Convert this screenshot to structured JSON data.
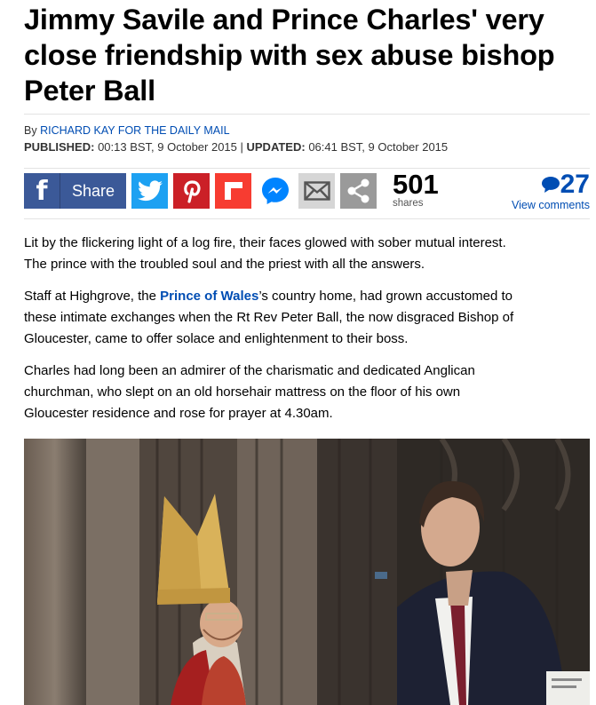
{
  "article": {
    "headline_lines": [
      "Jimmy Savile and Prince Charles' very",
      "close friendship with sex abuse bishop",
      "Peter Ball"
    ],
    "byline_prefix": "By ",
    "author": "RICHARD KAY FOR THE DAILY MAIL",
    "published_label": "PUBLISHED:",
    "published_value": " 00:13 BST, 9 October 2015 | ",
    "updated_label": "UPDATED:",
    "updated_value": " 06:41 BST, 9 October 2015"
  },
  "share": {
    "facebook_label": "Share",
    "share_count": "501",
    "share_count_label": "shares",
    "comment_count": "27",
    "comment_label": "View comments"
  },
  "body": {
    "p1_lines": [
      "Lit by the flickering light of a log fire, their faces glowed with sober mutual interest.",
      "The prince with the troubled soul and the priest with all the answers."
    ],
    "p2_line1_pre": "Staff at Highgrove, the ",
    "p2_link": "Prince of Wales",
    "p2_line1_post": "’s country home, had grown accustomed to",
    "p2_lines_rest": [
      "these intimate exchanges when the Rt Rev Peter Ball, the now disgraced Bishop of",
      "Gloucester, came to offer solace and enlightenment to their boss."
    ],
    "p3_lines": [
      "Charles had long been an admirer of the charismatic and dedicated Anglican",
      "churchman, who slept on an old horsehair mattress on the floor of his own",
      "Gloucester residence and rose for prayer at 4.30am."
    ]
  },
  "colors": {
    "facebook": "#3b5998",
    "twitter": "#1da1f2",
    "pinterest": "#cb2027",
    "flipboard": "#f73c31",
    "link": "#004db3"
  },
  "icons": [
    "facebook-icon",
    "twitter-icon",
    "pinterest-icon",
    "flipboard-icon",
    "messenger-icon",
    "email-icon",
    "share-icon",
    "comment-bubble-icon"
  ]
}
